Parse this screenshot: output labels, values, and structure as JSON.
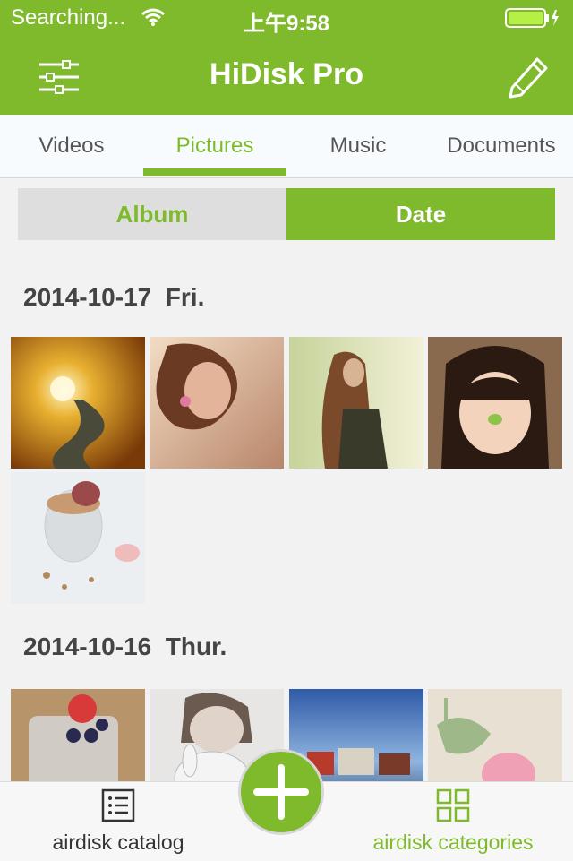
{
  "status": {
    "carrier": "Searching...",
    "time": "上午9:58"
  },
  "navbar": {
    "title": "HiDisk Pro"
  },
  "tabs": [
    {
      "label": "Videos"
    },
    {
      "label": "Pictures",
      "active": true
    },
    {
      "label": "Music"
    },
    {
      "label": "Documents"
    }
  ],
  "segment": {
    "album": "Album",
    "date": "Date",
    "selected": "Date"
  },
  "groups": [
    {
      "date": "2014-10-17",
      "day": "Fri.",
      "photo_count": 5
    },
    {
      "date": "2014-10-16",
      "day": "Thur.",
      "photo_count": 4
    }
  ],
  "bottom": {
    "left_label": "airdisk catalog",
    "right_label": "airdisk categories"
  },
  "colors": {
    "accent": "#7fba2c",
    "background": "#f2f2f2"
  },
  "icons": {
    "menu": "sliders-icon",
    "edit": "pencil-icon",
    "catalog": "list-icon",
    "categories": "grid-icon",
    "add": "plus-icon"
  }
}
